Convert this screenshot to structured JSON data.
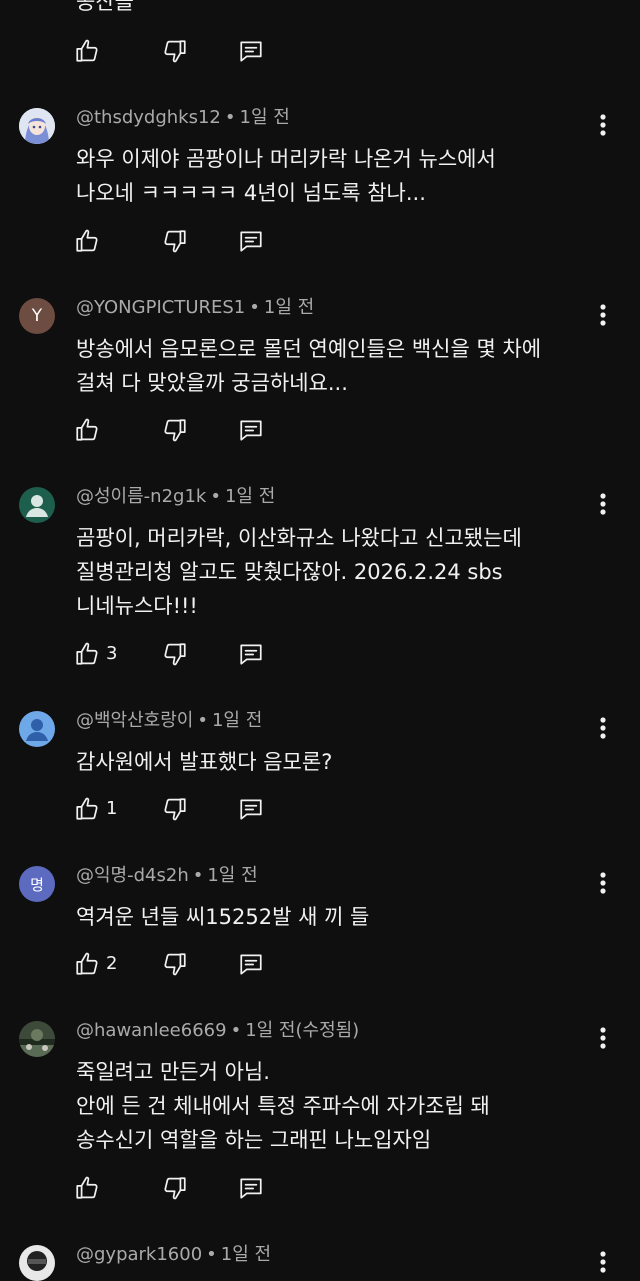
{
  "top_partial": {
    "text": "공산을"
  },
  "comments": [
    {
      "handle": "@thsdydghks12",
      "time": "1일 전",
      "lines": [
        "와우 이제야 곰팡이나 머리카락 나온거 뉴스에서",
        "나오네 ㅋㅋㅋㅋㅋ 4년이 넘도록 참나..."
      ],
      "likes": ""
    },
    {
      "handle": "@YONGPICTURES1",
      "time": "1일 전",
      "avatar_letter": "Y",
      "lines": [
        "방송에서 음모론으로 몰던 연예인들은 백신을 몇 차에",
        "걸쳐 다 맞았을까 궁금하네요..."
      ],
      "likes": ""
    },
    {
      "handle": "@성이름-n2g1k",
      "time": "1일 전",
      "lines": [
        "곰팡이, 머리카락, 이산화규소 나왔다고 신고됐는데",
        "질병관리청 알고도 맞췄다잖아. 2026.2.24 sbs",
        "니네뉴스다!!!"
      ],
      "likes": "3"
    },
    {
      "handle": "@백악산호랑이",
      "time": "1일 전",
      "lines": [
        "감사원에서 발표했다 음모론?"
      ],
      "likes": "1"
    },
    {
      "handle": "@익명-d4s2h",
      "time": "1일 전",
      "avatar_letter": "명",
      "lines": [
        "역겨운 년들 씨15252발 새 끼 들"
      ],
      "likes": "2"
    },
    {
      "handle": "@hawanlee6669",
      "time": "1일 전(수정됨)",
      "lines": [
        "죽일려고 만든거 아님.",
        "안에 든 건 체내에서 특정 주파수에 자가조립 돼",
        "송수신기 역할을 하는 그래핀 나노입자임"
      ],
      "likes": ""
    },
    {
      "handle": "@gypark1600",
      "time": "1일 전",
      "lines": [],
      "likes": ""
    }
  ],
  "colors": {
    "background": "#0f0f0f",
    "text": "#f1f1f1",
    "meta": "#aaaaaa",
    "avatar_y": "#6d4c41",
    "avatar_teal": "#1e5e4d",
    "avatar_blue": "#6fa8e8",
    "avatar_purple": "#5c6bc0"
  },
  "icons": {
    "like": "thumb-up-icon",
    "dislike": "thumb-down-icon",
    "reply": "comment-icon",
    "more": "more-vertical-icon"
  }
}
